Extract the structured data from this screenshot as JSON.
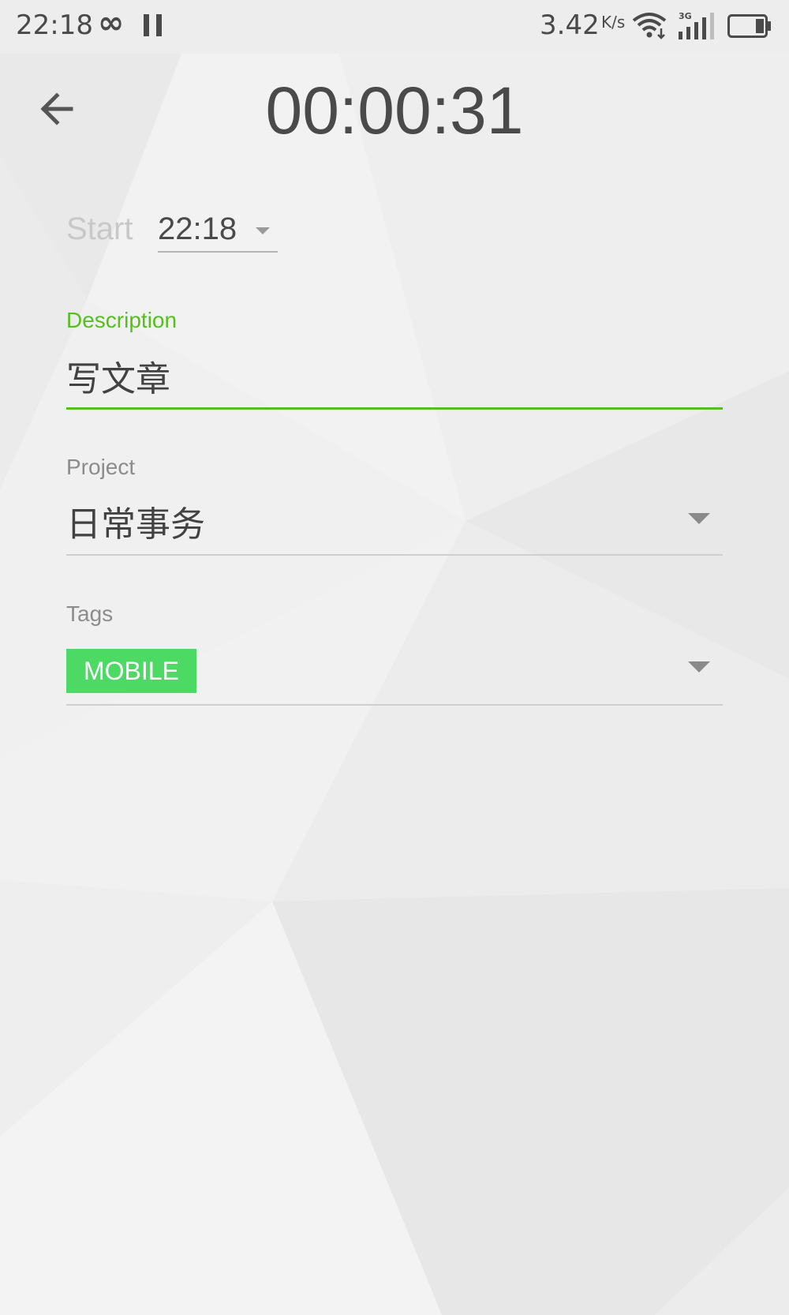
{
  "status_bar": {
    "time": "22:18",
    "infinity_glyph": "∞",
    "net_speed": "3.42",
    "net_speed_unit": "K/s",
    "network_type": "3G",
    "icons": [
      "infinity-icon",
      "pause-icon",
      "wifi-icon",
      "signal-icon",
      "battery-icon"
    ]
  },
  "header": {
    "back_icon": "arrow-left-icon",
    "timer": "00:00:31"
  },
  "start": {
    "label": "Start",
    "value": "22:18"
  },
  "description": {
    "label": "Description",
    "value": "写文章"
  },
  "project": {
    "label": "Project",
    "value": "日常事务"
  },
  "tags": {
    "label": "Tags",
    "items": [
      "MOBILE"
    ]
  },
  "colors": {
    "accent": "#54c01e",
    "tag_chip": "#4cd964",
    "background": "#efefef",
    "text_primary": "#424242",
    "text_secondary": "#8c8c8c"
  }
}
